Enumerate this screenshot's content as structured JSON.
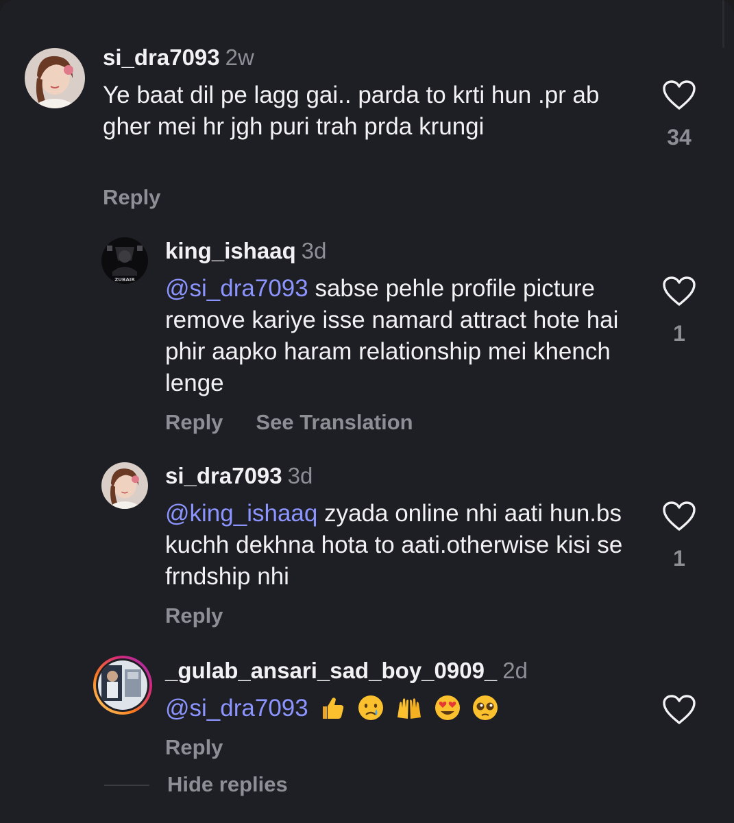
{
  "comments": [
    {
      "username": "si_dra7093",
      "time": "2w",
      "mention": "",
      "text": "Ye baat dil pe lagg gai.. parda to krti hun .pr ab gher mei hr jgh puri trah prda krungi",
      "likes": "34",
      "actions": [
        "Reply"
      ],
      "avatar": "woman-portrait-avatar"
    },
    {
      "username": "king_ishaaq",
      "time": "3d",
      "mention": "@si_dra7093",
      "text": " sabse pehle profile picture remove kariye isse namard attract hote hai phir aapko haram relationship mei khench lenge",
      "likes": "1",
      "actions": [
        "Reply",
        "See Translation"
      ],
      "avatar": "dark-logo-avatar",
      "avatar_caption": "ZUBAIR"
    },
    {
      "username": "si_dra7093",
      "time": "3d",
      "mention": "@king_ishaaq",
      "text": " zyada online nhi aati hun.bs kuchh dekhna hota to aati.otherwise kisi se frndship nhi",
      "likes": "1",
      "actions": [
        "Reply"
      ],
      "avatar": "woman-portrait-avatar"
    },
    {
      "username": "_gulab_ansari_sad_boy_0909_",
      "time": "2d",
      "mention": "@si_dra7093",
      "text": "",
      "emojis": [
        "thumbs-up",
        "crying-face",
        "raising-hands",
        "heart-eyes",
        "pleading-face"
      ],
      "likes": "",
      "actions": [
        "Reply"
      ],
      "avatar": "story-ring-avatar"
    }
  ],
  "hide_replies_label": "Hide replies",
  "colors": {
    "background": "#1e1f24",
    "text": "#f2f2f4",
    "secondary": "#8e8f96",
    "mention": "#8c95ff",
    "story_ring": [
      "#feda75",
      "#fa7e1e",
      "#d62976",
      "#962fbf"
    ]
  }
}
